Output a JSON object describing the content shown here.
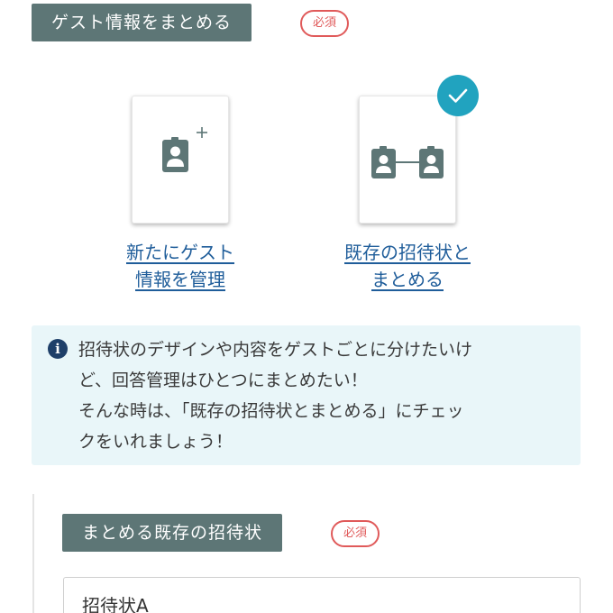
{
  "guest_section": {
    "label": "ゲスト情報をまとめる",
    "required_badge": "必須"
  },
  "options": [
    {
      "link_line1": "新たにゲスト",
      "link_line2": "情報を管理",
      "icon": "badge-plus-icon",
      "selected": false
    },
    {
      "link_line1": "既存の招待状と",
      "link_line2": "まとめる",
      "icon": "two-badges-linked-icon",
      "selected": true
    }
  ],
  "info": {
    "icon": "info-icon",
    "lines": [
      "招待状のデザインや内容をゲストごとに分けたいけ",
      "ど、回答管理はひとつにまとめたい！",
      "そんな時は、「既存の招待状とまとめる」にチェッ",
      "クをいれましょう！"
    ]
  },
  "merge_section": {
    "label": "まとめる既存の招待状",
    "required_badge": "必須",
    "input_value": "招待状A"
  },
  "colors": {
    "label_bg": "#5d7676",
    "required": "#e05a5a",
    "link": "#1f5d9a",
    "icon": "#5d7676",
    "check": "#21a3bf",
    "info_bg": "#e9f6f9",
    "info_icon": "#1e3f69"
  }
}
